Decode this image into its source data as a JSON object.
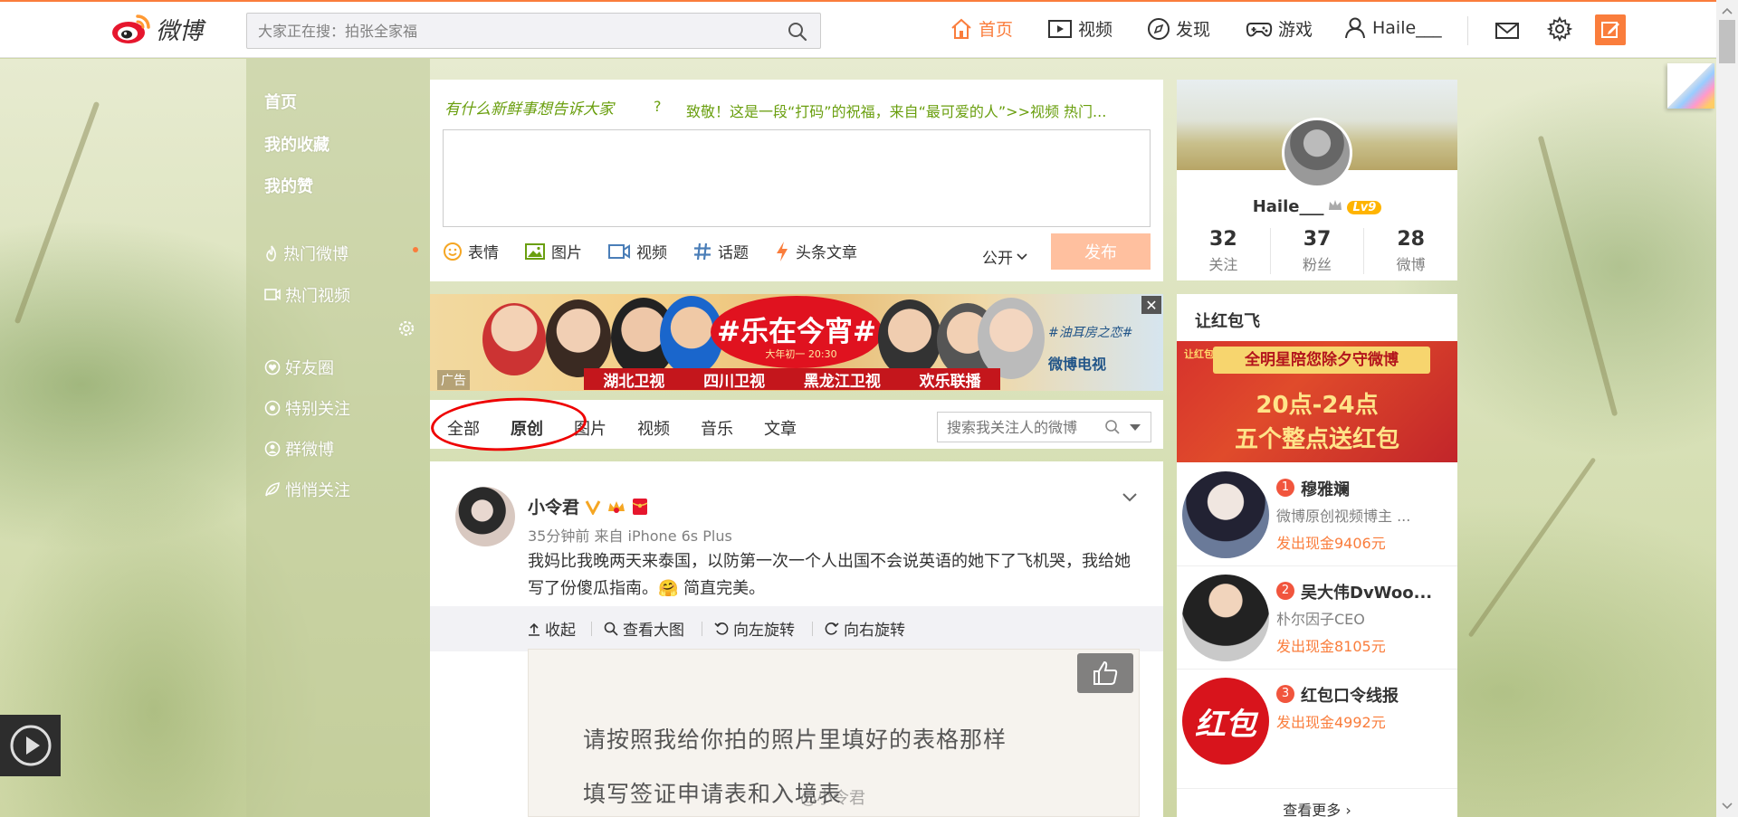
{
  "topbar": {
    "logo_text": "微博",
    "search_placeholder": "大家正在搜：拍张全家福",
    "nav": [
      {
        "label": "首页",
        "icon": "home-icon",
        "active": true
      },
      {
        "label": "视频",
        "icon": "video-icon",
        "active": false
      },
      {
        "label": "发现",
        "icon": "compass-icon",
        "active": false
      },
      {
        "label": "游戏",
        "icon": "gamepad-icon",
        "active": false
      },
      {
        "label": "Haile___",
        "icon": "user-icon",
        "active": false
      }
    ],
    "accent_color": "#fa7d3c"
  },
  "sidebar": {
    "items": [
      {
        "label": "首页"
      },
      {
        "label": "我的收藏"
      },
      {
        "label": "我的赞"
      },
      {
        "label": "热门微博"
      },
      {
        "label": "热门视频"
      },
      {
        "label": "好友圈"
      },
      {
        "label": "特别关注"
      },
      {
        "label": "群微博"
      },
      {
        "label": "悄悄关注"
      }
    ]
  },
  "publisher": {
    "title": "有什么新鲜事想告诉大家",
    "hot_topic": "致敬！这是一段“打码”的祝福，来自“最可爱的人”>>视频 热门...",
    "tools": [
      "表情",
      "图片",
      "视频",
      "话题",
      "头条文章"
    ],
    "visibility": "公开",
    "submit": "发布"
  },
  "ad": {
    "title": "#乐在今宵#",
    "time": "大年初一 20:30",
    "channels": [
      "湖北卫视",
      "四川卫视",
      "黑龙江卫视",
      "欢乐联播"
    ],
    "label": "广告",
    "brand_slogan": "#油耳房之恋#",
    "brand": "微博电视"
  },
  "feed_tabs": {
    "tabs": [
      "全部",
      "原创",
      "图片",
      "视频",
      "音乐",
      "文章"
    ],
    "active_index": 1,
    "search_placeholder": "搜索我关注人的微博"
  },
  "post": {
    "author": "小令君",
    "meta": "35分钟前 来自 iPhone 6s Plus",
    "text": "我妈比我晚两天来泰国，以防第一次一个人出国不会说英语的她下了飞机哭，我给她写了份傻瓜指南。🤗 简直完美。",
    "actions": [
      "收起",
      "查看大图",
      "向左旋转",
      "向右旋转"
    ],
    "image_line1": "请按照我给你拍的照片里填好的表格那样",
    "image_line2": "填写签证申请表和入境表",
    "watermark": "@小令君"
  },
  "profile": {
    "name": "Haile___",
    "level": "Lv9",
    "stats": [
      {
        "value": "32",
        "label": "关注"
      },
      {
        "value": "37",
        "label": "粉丝"
      },
      {
        "value": "28",
        "label": "微博"
      }
    ]
  },
  "red_packet": {
    "title": "让红包飞",
    "banner_top": "全明星陪您除夕守微博",
    "banner_tag": "让红包飞",
    "banner_line1": "20点-24点",
    "banner_line2": "五个整点送红包",
    "ranks": [
      {
        "num": "1",
        "name": "穆雅斓",
        "desc": "微博原创视频博主 ...",
        "cash": "发出现金9406元"
      },
      {
        "num": "2",
        "name": "吴大伟DvWoo...",
        "desc": "朴尔因子CEO",
        "cash": "发出现金8105元"
      },
      {
        "num": "3",
        "name": "红包口令线报",
        "desc": "",
        "cash": "发出现金4992元"
      }
    ],
    "rank3_avatar_text": "红包",
    "more": "查看更多"
  }
}
